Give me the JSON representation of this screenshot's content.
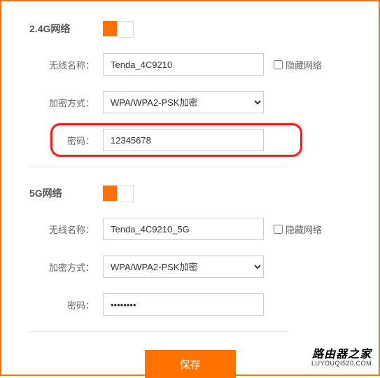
{
  "section24": {
    "title": "2.4G网络",
    "ssid_label": "无线名称：",
    "ssid_value": "Tenda_4C9210",
    "hide_label": "隐藏网络",
    "encrypt_label": "加密方式：",
    "encrypt_value": "WPA/WPA2-PSK加密",
    "password_label": "密码：",
    "password_value": "12345678"
  },
  "section5": {
    "title": "5G网络",
    "ssid_label": "无线名称：",
    "ssid_value": "Tenda_4C9210_5G",
    "hide_label": "隐藏网络",
    "encrypt_label": "加密方式：",
    "encrypt_value": "WPA/WPA2-PSK加密",
    "password_label": "密码：",
    "password_value": "••••••••"
  },
  "save_label": "保存",
  "watermark": {
    "title": "路由器之家",
    "url": "LUYOUQI520.COM"
  }
}
